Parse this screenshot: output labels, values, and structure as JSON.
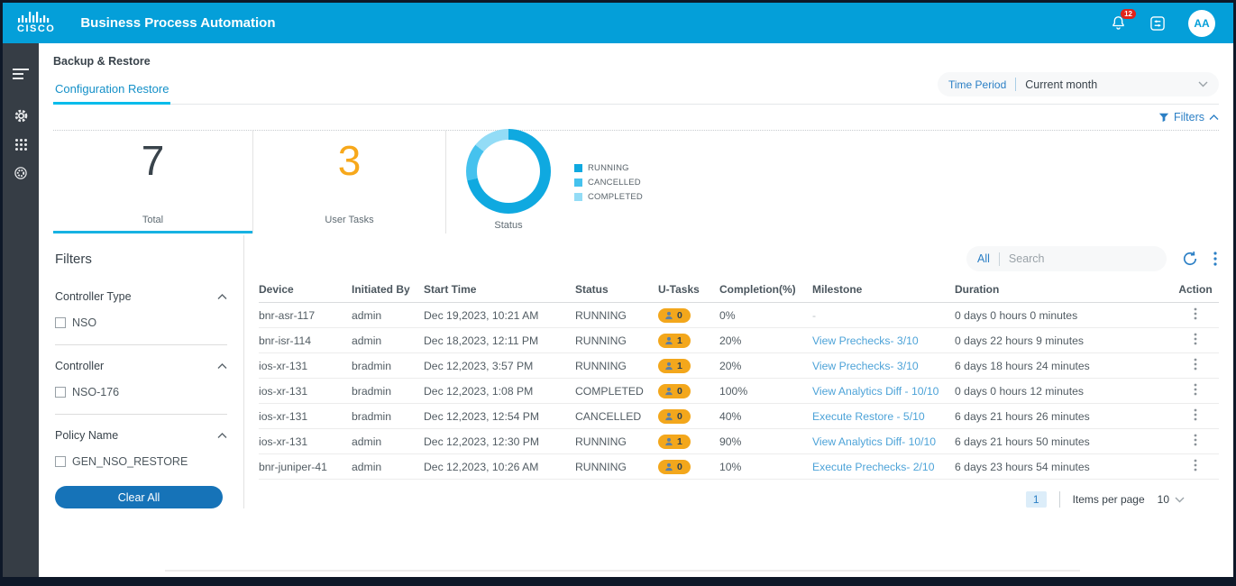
{
  "header": {
    "brand": "CISCO",
    "title": "Business Process Automation",
    "notification_count": "12",
    "avatar_initials": "AA"
  },
  "page": {
    "breadcrumb": "Backup & Restore",
    "tab": "Configuration Restore",
    "time_period_label": "Time Period",
    "time_period_value": "Current month",
    "filters_toggle": "Filters"
  },
  "stats": {
    "total": {
      "value": "7",
      "label": "Total"
    },
    "user_tasks": {
      "value": "3",
      "label": "User Tasks"
    },
    "status_label": "Status"
  },
  "chart_data": {
    "type": "pie",
    "donut": true,
    "title": "Status",
    "categories": [
      "RUNNING",
      "CANCELLED",
      "COMPLETED"
    ],
    "values": [
      5,
      1,
      1
    ],
    "colors": [
      "#0fa9e0",
      "#45c2ee",
      "#93dcf6"
    ],
    "legend_position": "right"
  },
  "filter_panel": {
    "title": "Filters",
    "groups": [
      {
        "label": "Controller Type",
        "options": [
          {
            "label": "NSO",
            "checked": false
          }
        ]
      },
      {
        "label": "Controller",
        "options": [
          {
            "label": "NSO-176",
            "checked": false
          }
        ]
      },
      {
        "label": "Policy Name",
        "options": [
          {
            "label": "GEN_NSO_RESTORE",
            "checked": false
          }
        ]
      }
    ],
    "clear_all_label": "Clear All"
  },
  "toolbar": {
    "scope_label": "All",
    "search_placeholder": "Search"
  },
  "table": {
    "columns": [
      "Device",
      "Initiated By",
      "Start Time",
      "Status",
      "U-Tasks",
      "Completion(%)",
      "Milestone",
      "Duration",
      "Action"
    ],
    "rows": [
      {
        "device": "bnr-asr-117",
        "initiated_by": "admin",
        "start_time": "Dec 19,2023, 10:21 AM",
        "status": "RUNNING",
        "u_tasks": "0",
        "completion": "0%",
        "milestone": "-",
        "milestone_link": false,
        "duration": "0 days 0 hours 0 minutes"
      },
      {
        "device": "bnr-isr-114",
        "initiated_by": "admin",
        "start_time": "Dec 18,2023, 12:11 PM",
        "status": "RUNNING",
        "u_tasks": "1",
        "completion": "20%",
        "milestone": "View Prechecks- 3/10",
        "milestone_link": true,
        "duration": "0 days 22 hours 9 minutes"
      },
      {
        "device": "ios-xr-131",
        "initiated_by": "bradmin",
        "start_time": "Dec 12,2023, 3:57 PM",
        "status": "RUNNING",
        "u_tasks": "1",
        "completion": "20%",
        "milestone": "View Prechecks- 3/10",
        "milestone_link": true,
        "duration": "6 days 18 hours 24 minutes"
      },
      {
        "device": "ios-xr-131",
        "initiated_by": "bradmin",
        "start_time": "Dec 12,2023, 1:08 PM",
        "status": "COMPLETED",
        "u_tasks": "0",
        "completion": "100%",
        "milestone": "View Analytics Diff - 10/10",
        "milestone_link": true,
        "duration": "0 days 0 hours 12 minutes"
      },
      {
        "device": "ios-xr-131",
        "initiated_by": "bradmin",
        "start_time": "Dec 12,2023, 12:54 PM",
        "status": "CANCELLED",
        "u_tasks": "0",
        "completion": "40%",
        "milestone": "Execute Restore - 5/10",
        "milestone_link": true,
        "duration": "6 days 21 hours 26 minutes"
      },
      {
        "device": "ios-xr-131",
        "initiated_by": "admin",
        "start_time": "Dec 12,2023, 12:30 PM",
        "status": "RUNNING",
        "u_tasks": "1",
        "completion": "90%",
        "milestone": "View Analytics Diff- 10/10",
        "milestone_link": true,
        "duration": "6 days 21 hours 50 minutes"
      },
      {
        "device": "bnr-juniper-41",
        "initiated_by": "admin",
        "start_time": "Dec 12,2023, 10:26 AM",
        "status": "RUNNING",
        "u_tasks": "0",
        "completion": "10%",
        "milestone": "Execute Prechecks- 2/10",
        "milestone_link": true,
        "duration": "6 days 23 hours 54 minutes"
      }
    ]
  },
  "pagination": {
    "page": "1",
    "items_per_page_label": "Items per page",
    "items_per_page_value": "10"
  },
  "colors": {
    "header_bg": "#049fd9",
    "sidebar_bg": "#363d45",
    "accent": "#00bceb",
    "tab_blue": "#1490c8",
    "blue": "#2b7fc5",
    "orange": "#f7a81b",
    "link": "#4da3d8",
    "button_blue": "#1673b8",
    "badge_bg": "#f3a71c",
    "red": "#e2231a",
    "frame_bg": "#0e1828"
  }
}
